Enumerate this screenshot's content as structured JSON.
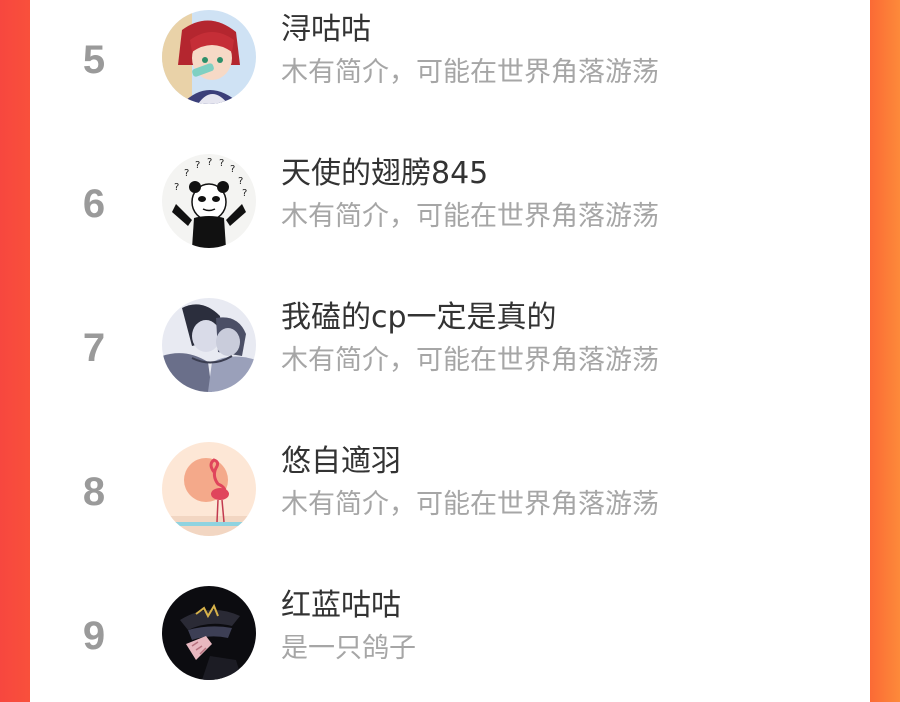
{
  "users": [
    {
      "rank": "5",
      "name": "浔咕咕",
      "bio": "木有简介，可能在世界角落游荡",
      "avatar_icon": "anime-boy-avatar-icon"
    },
    {
      "rank": "6",
      "name": "天使的翅膀845",
      "bio": "木有简介，可能在世界角落游荡",
      "avatar_icon": "panda-meme-avatar-icon"
    },
    {
      "rank": "7",
      "name": "我磕的cp一定是真的",
      "bio": "木有简介，可能在世界角落游荡",
      "avatar_icon": "sketch-couple-avatar-icon"
    },
    {
      "rank": "8",
      "name": "悠自適羽",
      "bio": "木有简介，可能在世界角落游荡",
      "avatar_icon": "flamingo-sunset-avatar-icon"
    },
    {
      "rank": "9",
      "name": "红蓝咕咕",
      "bio": "是一只鸽子",
      "avatar_icon": "dark-hat-avatar-icon"
    }
  ],
  "colors": {
    "background_left": "#f7473f",
    "background_right": "#fd8a3a",
    "rank_color": "#9a9a9a",
    "name_color": "#333333",
    "bio_color": "#a6a6a6"
  }
}
